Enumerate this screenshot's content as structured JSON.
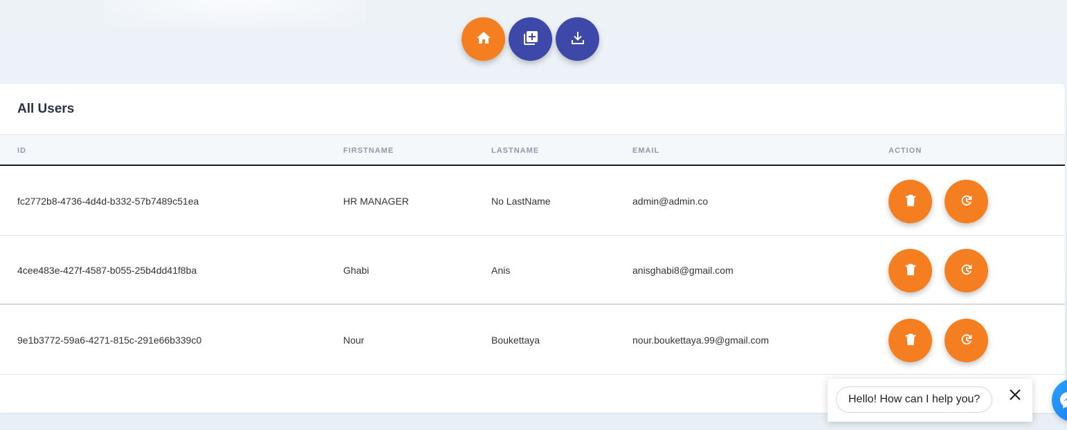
{
  "toolbar": {
    "buttons": [
      {
        "icon": "home-icon",
        "color": "#f57f20"
      },
      {
        "icon": "add-library-icon",
        "color": "#3d48a8"
      },
      {
        "icon": "download-icon",
        "color": "#3d48a8"
      }
    ]
  },
  "table": {
    "title": "All Users",
    "columns": [
      "ID",
      "FIRSTNAME",
      "LASTNAME",
      "EMAIL",
      "ACTION"
    ],
    "rows": [
      {
        "id": "fc2772b8-4736-4d4d-b332-57b7489c51ea",
        "firstname": "HR MANAGER",
        "lastname": "No LastName",
        "email": "admin@admin.co"
      },
      {
        "id": "4cee483e-427f-4587-b055-25b4dd41f8ba",
        "firstname": "Ghabi",
        "lastname": "Anis",
        "email": "anisghabi8@gmail.com"
      },
      {
        "id": "9e1b3772-59a6-4271-815c-291e66b339c0",
        "firstname": "Nour",
        "lastname": "Boukettaya",
        "email": "nour.boukettaya.99@gmail.com"
      }
    ],
    "row_actions": [
      {
        "icon": "trash-icon"
      },
      {
        "icon": "reset-icon"
      }
    ]
  },
  "chat": {
    "greeting": "Hello! How can I help you?",
    "close_icon": "close-icon",
    "launcher_icon": "messenger-icon"
  },
  "colors": {
    "accent_orange": "#f57f20",
    "accent_indigo": "#3d48a8",
    "title_text": "#2b2f4a"
  }
}
